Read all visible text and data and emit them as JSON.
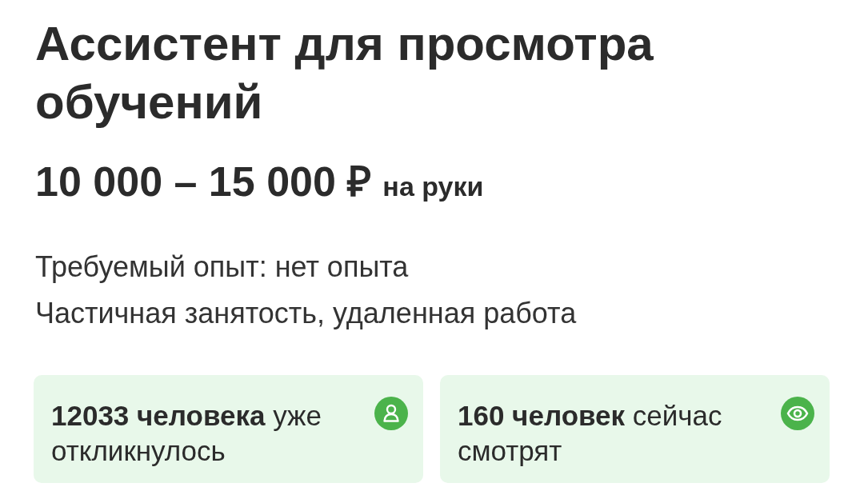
{
  "vacancy": {
    "title": "Ассистент для просмотра обучений",
    "salary": {
      "amount": "10 000 – 15 000 ₽",
      "note": "на руки"
    },
    "details": [
      "Требуемый опыт: нет опыта",
      "Частичная занятость, удаленная работа"
    ],
    "stats": [
      {
        "kind": "responded",
        "text": "**12033 человека** уже откликнулось"
      },
      {
        "kind": "viewing",
        "text": "**160 человек** сейчас смотрят"
      }
    ]
  }
}
